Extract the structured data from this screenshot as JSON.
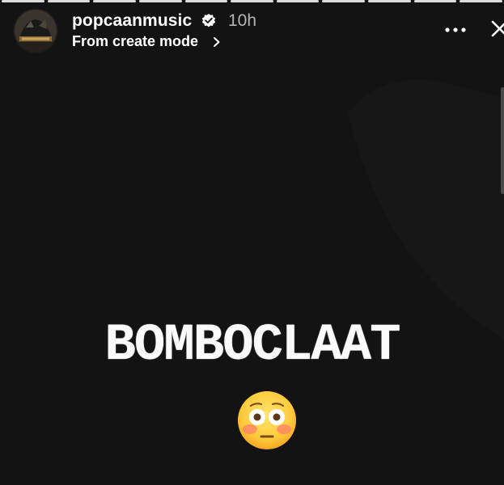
{
  "story": {
    "username": "popcaanmusic",
    "time_ago": "10h",
    "subtitle": "From create mode",
    "caption": "BOMBOCLAAT",
    "emoji": "flushed-face-emoji",
    "progress_segments": 11,
    "active_segments": 11
  },
  "colors": {
    "background": "#131313",
    "text": "#ffffff",
    "muted": "#b4b4b4"
  }
}
